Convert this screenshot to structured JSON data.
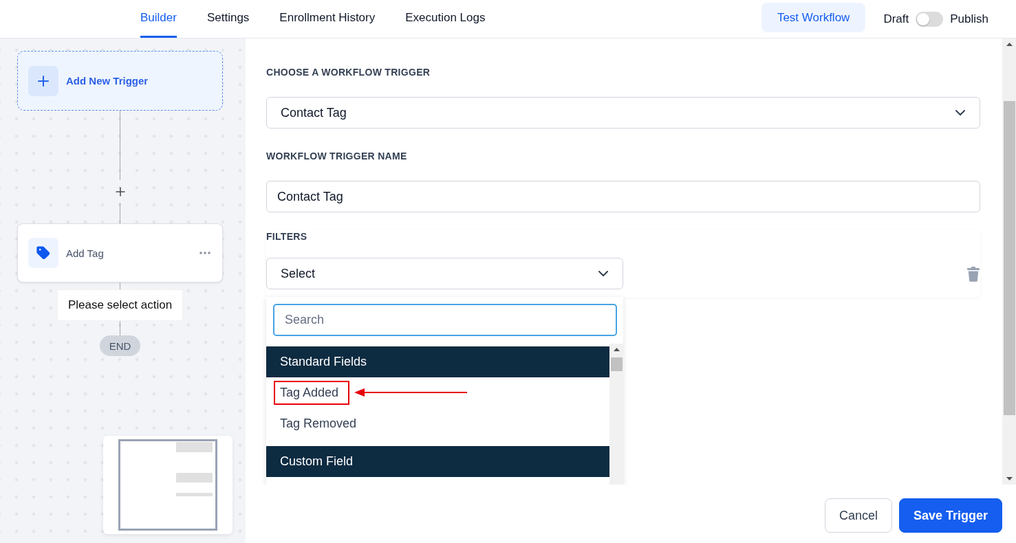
{
  "header": {
    "tabs": [
      {
        "label": "Builder",
        "selected": true
      },
      {
        "label": "Settings",
        "selected": false
      },
      {
        "label": "Enrollment History",
        "selected": false
      },
      {
        "label": "Execution Logs",
        "selected": false
      }
    ],
    "test_button": "Test Workflow",
    "publish_toggle": {
      "off_label": "Draft",
      "on_label": "Publish",
      "on": false
    }
  },
  "canvas": {
    "trigger_node": "Add New Trigger",
    "action_node": "Add Tag",
    "action_hint": "Please select action",
    "end_node": "END"
  },
  "trigger_panel": {
    "trigger_type": {
      "label": "CHOOSE A WORKFLOW TRIGGER",
      "value": "Contact Tag"
    },
    "trigger_name": {
      "label": "WORKFLOW TRIGGER NAME",
      "value": "Contact Tag"
    },
    "filters": {
      "label": "FILTERS",
      "field": {
        "value": "Select",
        "expanded": true
      },
      "search": {
        "placeholder": "Search"
      },
      "groups": [
        {
          "name": "Standard Fields",
          "options": [
            {
              "label": "Tag Added",
              "highlighted": true
            },
            {
              "label": "Tag Removed",
              "highlighted": false
            }
          ]
        },
        {
          "name": "Custom Field"
        }
      ]
    }
  },
  "footer": {
    "buttons": [
      {
        "label": "Cancel",
        "kind": "secondary"
      },
      {
        "label": "Save Trigger",
        "kind": "primary"
      }
    ]
  }
}
